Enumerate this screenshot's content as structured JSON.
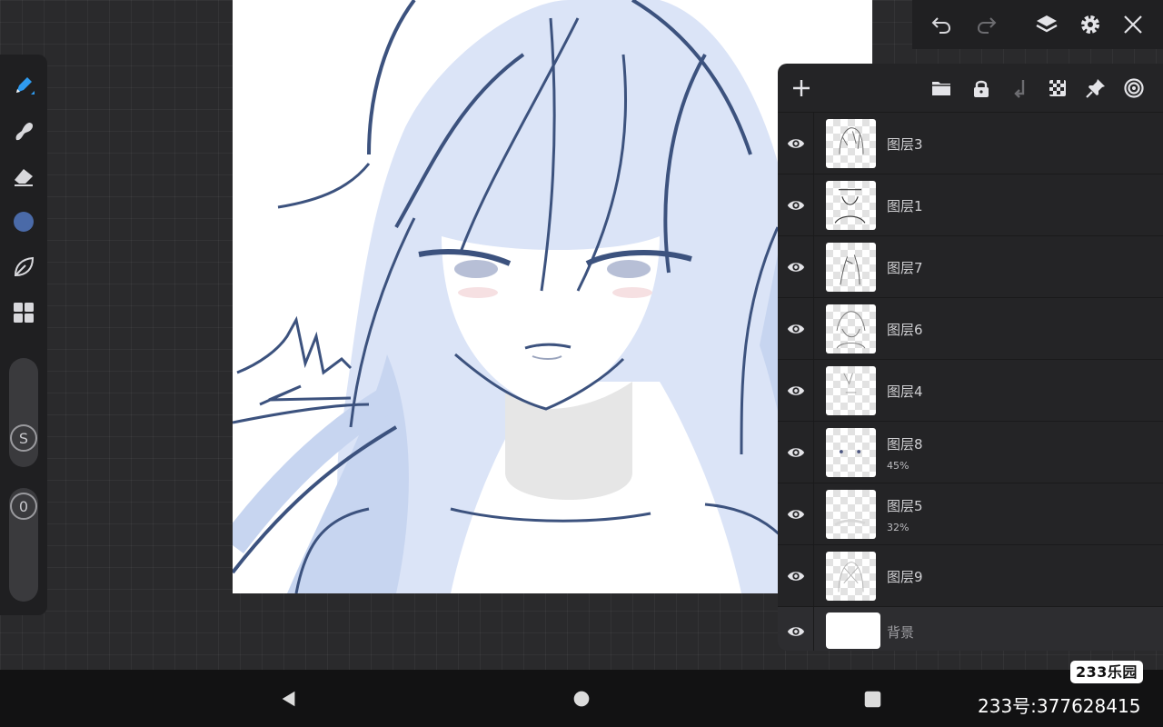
{
  "colors": {
    "current_brush": "#4a6aa8",
    "line_art": "#3c527e",
    "hair_shadow": "#c7d5f0",
    "hair_fill": "#dbe4f7",
    "accent_blue": "#2f9bf0"
  },
  "toolbar": {
    "tools": [
      "brush-icon",
      "smudge-icon",
      "eraser-icon",
      "color-swatch",
      "leaf-icon",
      "grid-icon"
    ],
    "size_slider_label": "S",
    "opacity_slider_label": "0"
  },
  "topbar": {
    "buttons": [
      "undo-icon",
      "redo-icon",
      "layers-icon",
      "gear-icon",
      "close-icon"
    ]
  },
  "layers_panel": {
    "header_buttons": [
      "add-layer-icon",
      "folder-icon",
      "lock-icon",
      "merge-down-icon",
      "transparency-icon",
      "pin-icon",
      "target-icon"
    ],
    "layers": [
      {
        "name": "图层3",
        "opacity": ""
      },
      {
        "name": "图层1",
        "opacity": ""
      },
      {
        "name": "图层7",
        "opacity": ""
      },
      {
        "name": "图层6",
        "opacity": ""
      },
      {
        "name": "图层4",
        "opacity": ""
      },
      {
        "name": "图层8",
        "opacity": "45%"
      },
      {
        "name": "图层5",
        "opacity": "32%"
      },
      {
        "name": "图层9",
        "opacity": ""
      },
      {
        "name": "背景",
        "opacity": ""
      }
    ]
  },
  "navbar": {
    "buttons": [
      "back-icon",
      "home-icon",
      "recents-icon"
    ]
  },
  "watermark": {
    "logo": "233乐园",
    "id_text": "233号:377628415"
  }
}
